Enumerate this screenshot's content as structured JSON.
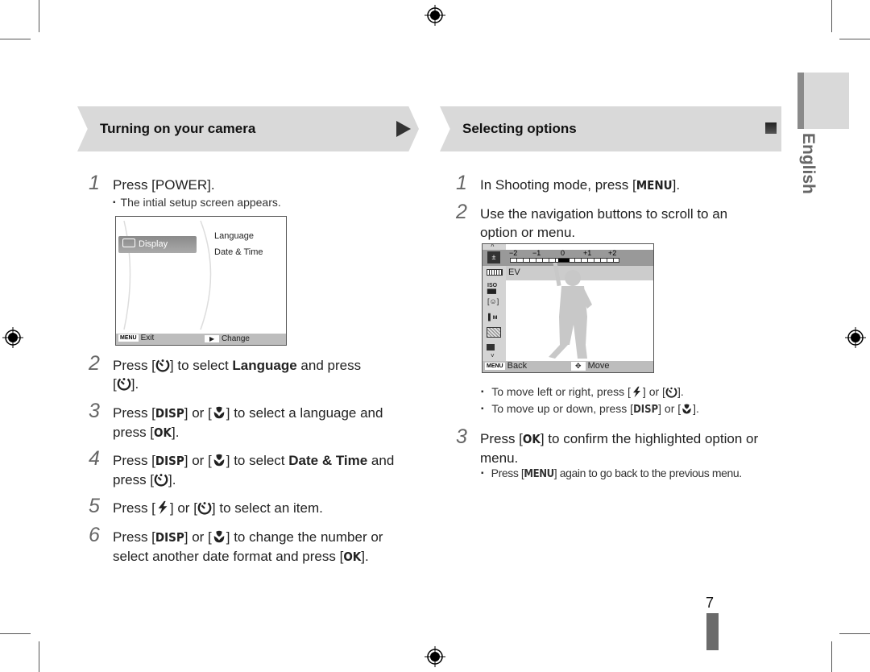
{
  "language_tab": "English",
  "page_number": "7",
  "left_section": {
    "title": "Turning on your camera",
    "steps": [
      {
        "num": "1",
        "parts": [
          "Press [",
          "POWER",
          "]."
        ],
        "note": "The intial setup screen appears."
      },
      {
        "num": "2",
        "line1_a": "Press [",
        "line1_b": "] to select ",
        "line1_bold": "Language",
        "line1_c": " and press",
        "line2_a": "[",
        "line2_b": "]."
      },
      {
        "num": "3",
        "line1_a": "Press [",
        "key_disp": "DISP",
        "line1_b": "] or [",
        "line1_c": "] to select a language and",
        "line2_a": "press [",
        "key_ok": "OK",
        "line2_b": "]."
      },
      {
        "num": "4",
        "line1_a": "Press [",
        "key_disp": "DISP",
        "line1_b": "] or [",
        "line1_c": "] to select ",
        "line1_bold": "Date & Time",
        "line1_d": " and",
        "line2_a": "press [",
        "line2_b": "]."
      },
      {
        "num": "5",
        "line1_a": "Press [",
        "line1_b": "] or [",
        "line1_c": "] to select an item."
      },
      {
        "num": "6",
        "line1_a": "Press [",
        "key_disp": "DISP",
        "line1_b": "] or [",
        "line1_c": "] to change the number or",
        "line2_a": "select another date format and press [",
        "key_ok": "OK",
        "line2_b": "]."
      }
    ],
    "screen": {
      "menu_item": "Display",
      "options": [
        "Language",
        "Date & Time"
      ],
      "footer_menu_tag": "MENU",
      "footer_left": "Exit",
      "footer_right": "Change"
    }
  },
  "right_section": {
    "title": "Selecting options",
    "step1": {
      "num": "1",
      "a": "In Shooting mode, press [",
      "key": "MENU",
      "b": "]."
    },
    "step2": {
      "num": "2",
      "line1": "Use the navigation buttons to scroll to an",
      "line2": "option or menu."
    },
    "screen": {
      "ev_scale": [
        "−2",
        "−1",
        "0",
        "+1",
        "+2"
      ],
      "ev_value": 0,
      "selected_label": "EV",
      "footer_menu_tag": "MENU",
      "footer_left": "Back",
      "footer_right": "Move"
    },
    "bullets": [
      {
        "a": "To move left or right, press [",
        "b": "] or [",
        "c": "]."
      },
      {
        "a": "To move up or down, press [",
        "key": "DISP",
        "b": "] or [",
        "c": "]."
      }
    ],
    "step3": {
      "num": "3",
      "a": "Press [",
      "key": "OK",
      "b": "] to confirm the highlighted option or",
      "line2": "menu."
    },
    "step3_note": {
      "a": "Press [",
      "key": "MENU",
      "b": "] again to go back to the previous menu."
    }
  }
}
